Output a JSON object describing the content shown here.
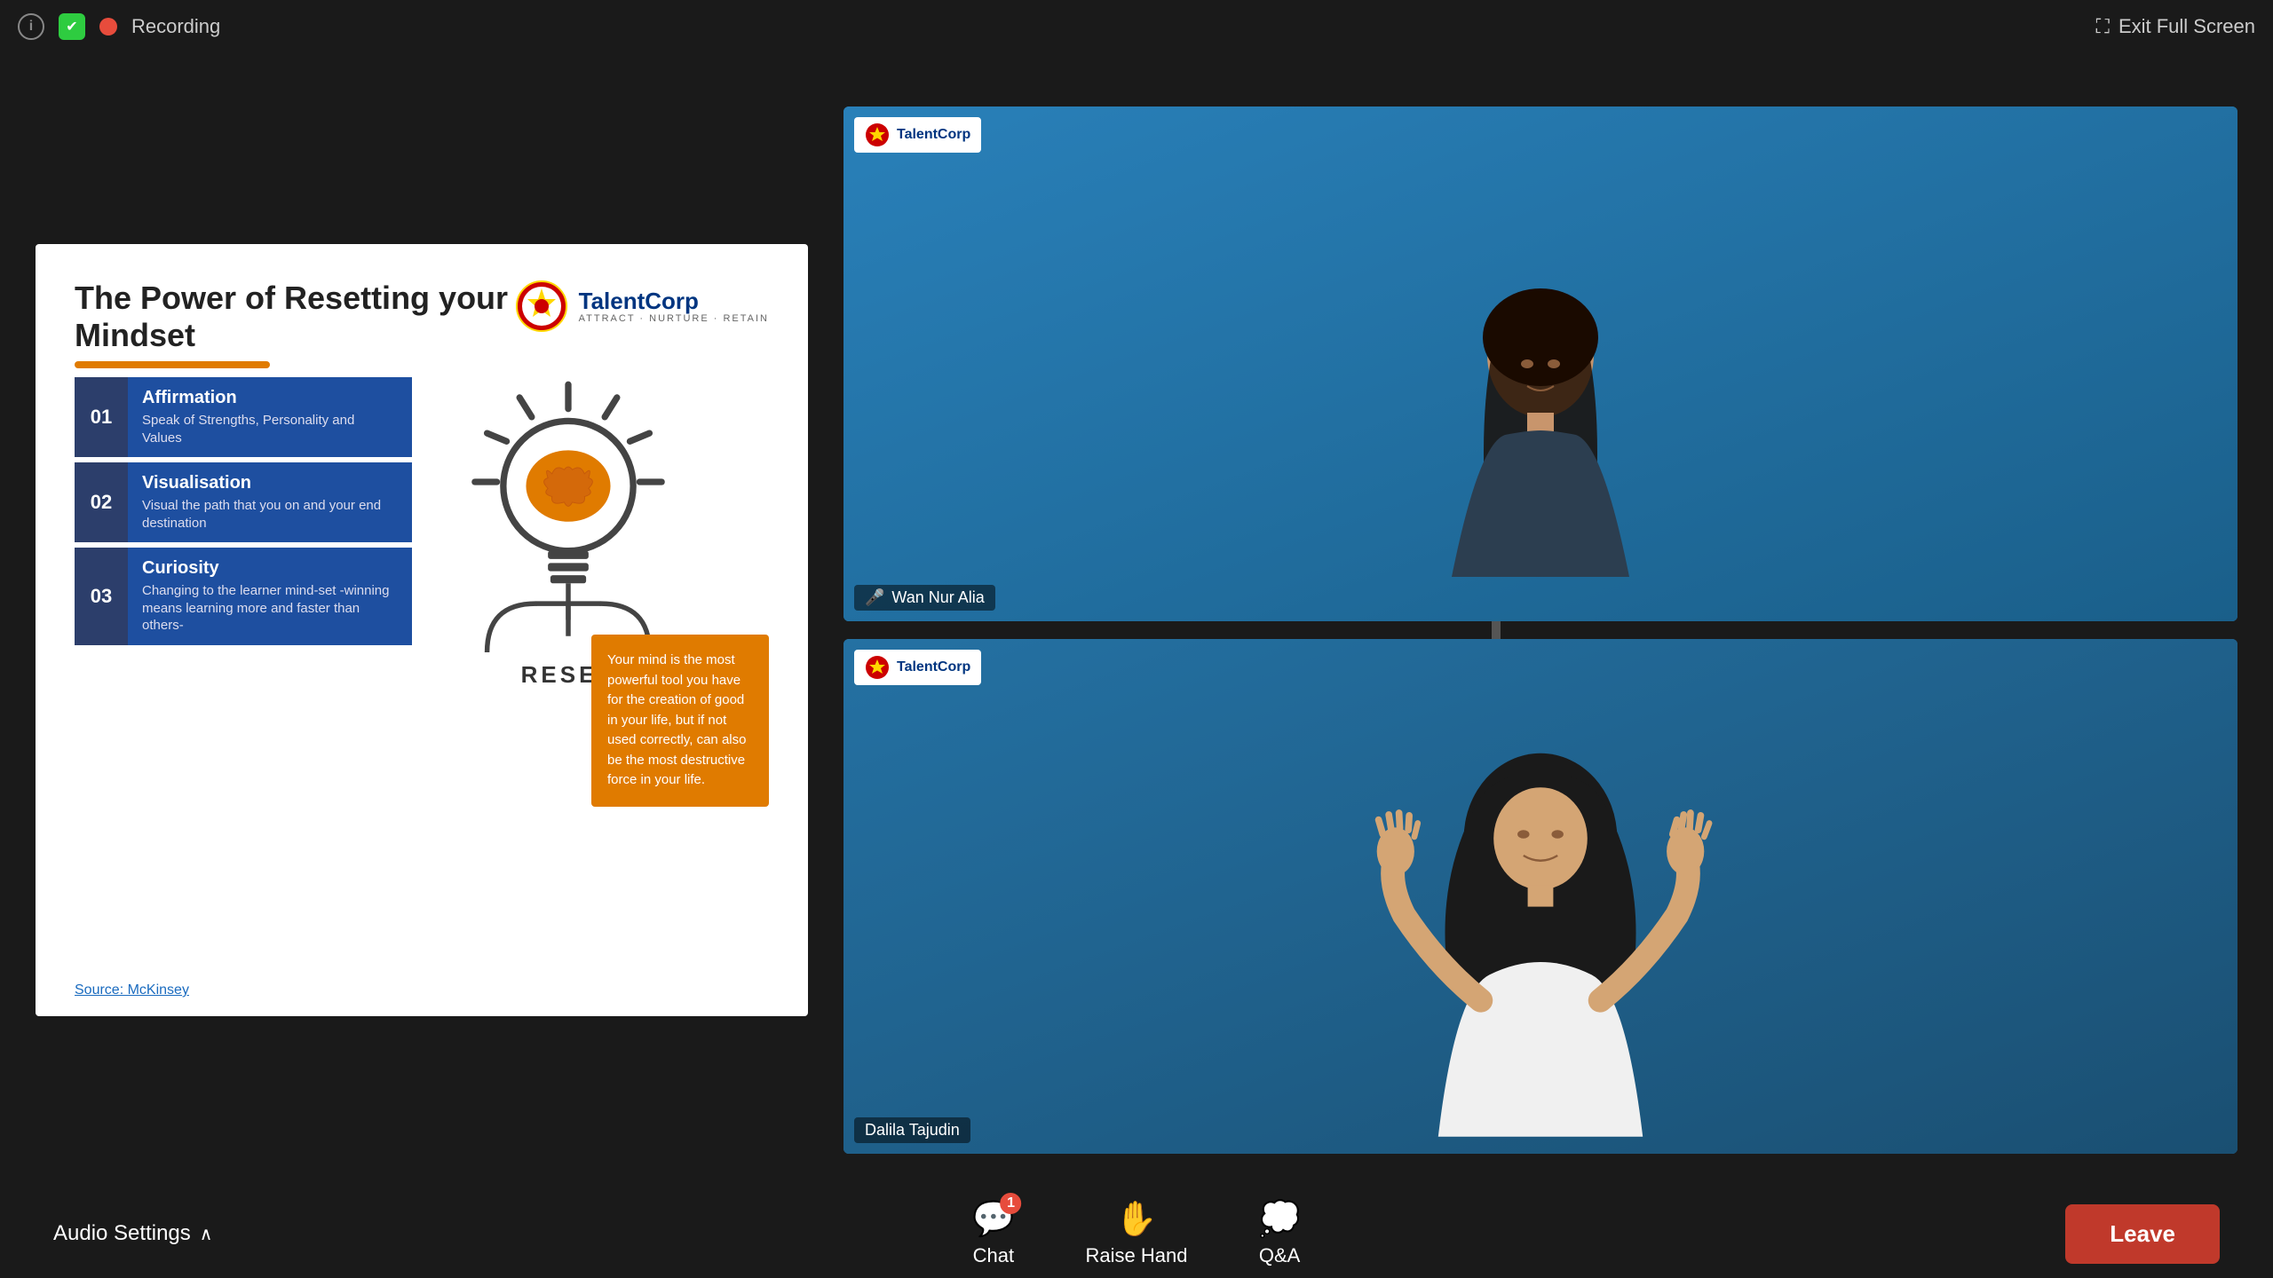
{
  "topBar": {
    "recordingLabel": "Recording",
    "exitFullscreenLabel": "Exit Full Screen"
  },
  "slide": {
    "title": "The Power of Resetting your Mindset",
    "logoText": "TalentCorp",
    "logoTagline": "ATTRACT · NURTURE · RETAIN",
    "items": [
      {
        "number": "01",
        "title": "Affirmation",
        "description": "Speak of Strengths, Personality and Values"
      },
      {
        "number": "02",
        "title": "Visualisation",
        "description": "Visual the path that you on and your end destination"
      },
      {
        "number": "03",
        "title": "Curiosity",
        "description": "Changing to the learner mind-set -winning means learning more and faster than others-"
      }
    ],
    "resetLabel": "RESET",
    "quote": "Your mind is the most powerful tool you have for the creation of good in your life, but if not used correctly, can also be the most destructive force in your life.",
    "sourceLabel": "Source: McKinsey"
  },
  "videoFeeds": [
    {
      "companyName": "TalentCorp",
      "speakerName": "Wan Nur Alia",
      "micIcon": "🎤"
    },
    {
      "companyName": "TalentCorp",
      "speakerName": "Dalila Tajudin"
    }
  ],
  "bottomBar": {
    "audioSettingsLabel": "Audio Settings",
    "controls": [
      {
        "id": "chat",
        "label": "Chat",
        "badge": "1"
      },
      {
        "id": "raise-hand",
        "label": "Raise Hand"
      },
      {
        "id": "qa",
        "label": "Q&A"
      }
    ],
    "leaveLabel": "Leave"
  }
}
